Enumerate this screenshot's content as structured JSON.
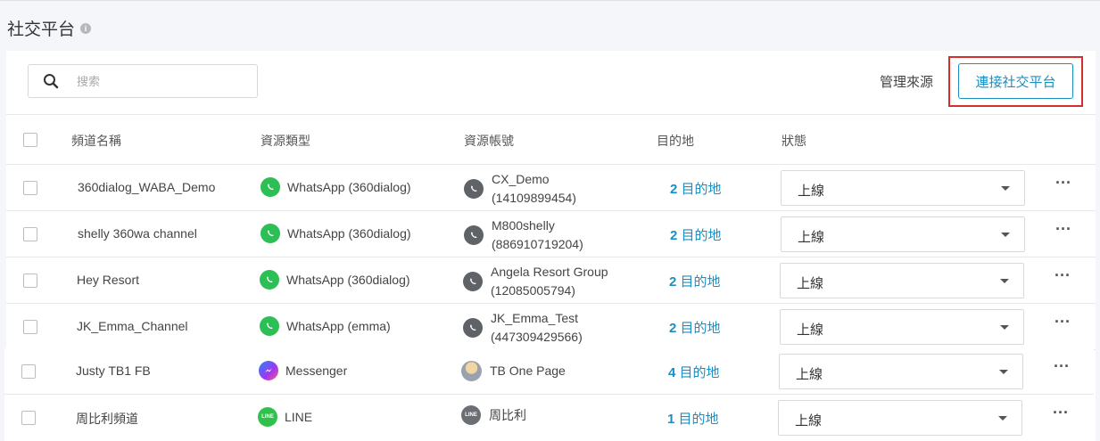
{
  "page": {
    "title": "社交平台"
  },
  "toolbar": {
    "search_placeholder": "搜索",
    "manage_label": "管理來源",
    "connect_label": "連接社交平台"
  },
  "table": {
    "headers": [
      "頻道名稱",
      "資源類型",
      "資源帳號",
      "目的地",
      "狀態"
    ],
    "rows": [
      {
        "name": "360dialog_WABA_Demo",
        "type": "WhatsApp (360dialog)",
        "type_icon": "whatsapp-icon",
        "account_name": "CX_Demo",
        "account_id": "(14109899454)",
        "account_icon": "whatsapp-gray-icon",
        "dest_count": "2",
        "dest_label": " 目的地",
        "status": "上線"
      },
      {
        "name": "shelly 360wa channel",
        "type": "WhatsApp (360dialog)",
        "type_icon": "whatsapp-icon",
        "account_name": "M800shelly",
        "account_id": "(886910719204)",
        "account_icon": "whatsapp-gray-icon",
        "dest_count": "2",
        "dest_label": " 目的地",
        "status": "上線"
      },
      {
        "name": "Hey Resort",
        "type": "WhatsApp (360dialog)",
        "type_icon": "whatsapp-icon",
        "account_name": "Angela Resort Group",
        "account_id": "(12085005794)",
        "account_icon": "whatsapp-gray-icon",
        "dest_count": "2",
        "dest_label": " 目的地",
        "status": "上線"
      },
      {
        "name": "JK_Emma_Channel",
        "type": "WhatsApp (emma)",
        "type_icon": "whatsapp-icon",
        "account_name": "JK_Emma_Test",
        "account_id": "(447309429566)",
        "account_icon": "whatsapp-gray-icon",
        "dest_count": "2",
        "dest_label": " 目的地",
        "status": "上線"
      },
      {
        "name": "Justy TB1 FB",
        "type": "Messenger",
        "type_icon": "messenger-icon",
        "account_name": "TB One Page",
        "account_id": "",
        "account_icon": "page-avatar-icon",
        "dest_count": "4",
        "dest_label": " 目的地",
        "status": "上線"
      },
      {
        "name": "周比利頻道",
        "type": "LINE",
        "type_icon": "line-icon",
        "account_name": "周比利",
        "account_id": "",
        "account_icon": "line-gray-icon",
        "dest_count": "1",
        "dest_label": " 目的地",
        "status": "上線"
      }
    ]
  },
  "icons": {
    "line_text": "LINE"
  },
  "colors": {
    "accent": "#1a8fc4",
    "highlight": "#d32f2f",
    "whatsapp": "#2bbf55",
    "line": "#2ec14b"
  }
}
